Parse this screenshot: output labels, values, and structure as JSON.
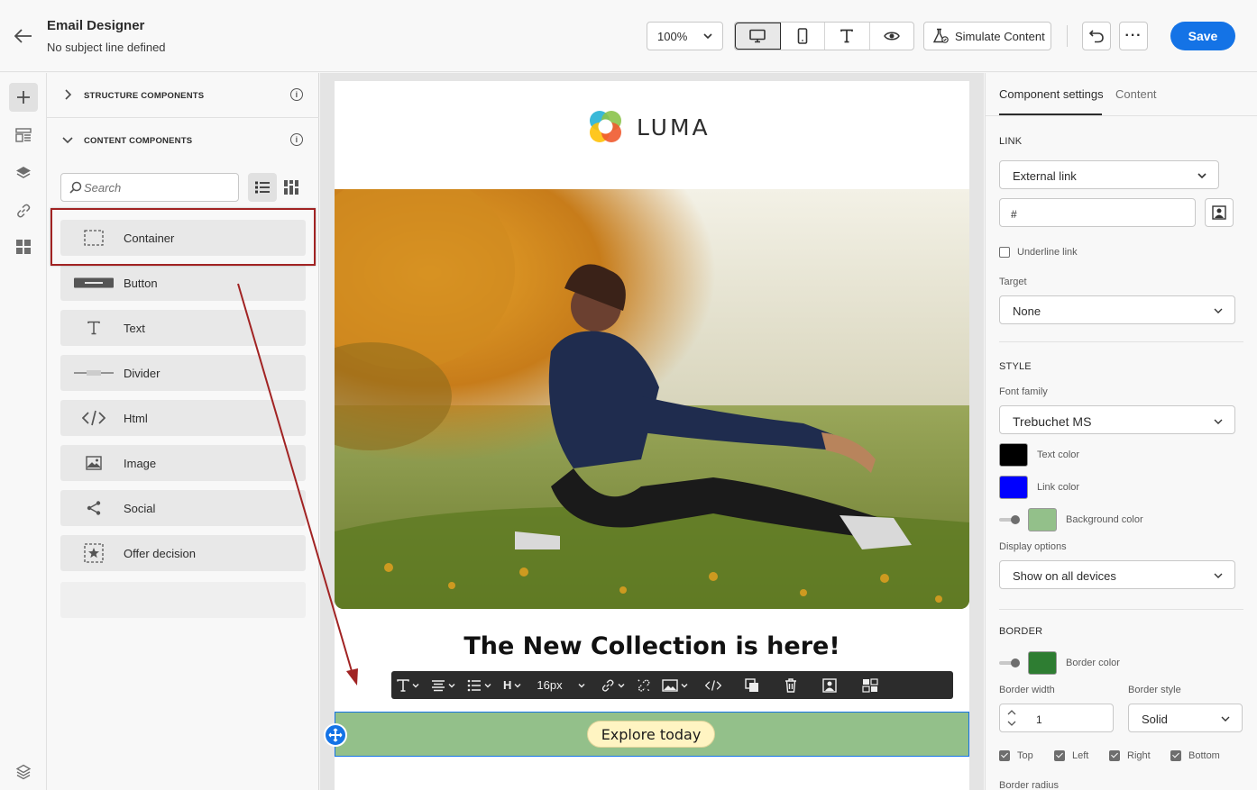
{
  "header": {
    "title": "Email Designer",
    "subtitle": "No subject line defined",
    "zoom": "100%",
    "simulate_label": "Simulate Content",
    "save_label": "Save"
  },
  "components_panel": {
    "structure_label": "STRUCTURE COMPONENTS",
    "content_label": "CONTENT COMPONENTS",
    "search_placeholder": "Search",
    "items": [
      {
        "label": "Container",
        "icon": "container-icon"
      },
      {
        "label": "Button",
        "icon": "button-icon"
      },
      {
        "label": "Text",
        "icon": "text-icon"
      },
      {
        "label": "Divider",
        "icon": "divider-icon"
      },
      {
        "label": "Html",
        "icon": "code-icon"
      },
      {
        "label": "Image",
        "icon": "image-icon"
      },
      {
        "label": "Social",
        "icon": "share-icon"
      },
      {
        "label": "Offer decision",
        "icon": "offer-icon"
      }
    ]
  },
  "canvas": {
    "logo_text": "LUMA",
    "headline": "The New Collection is here!",
    "cta_label": "Explore today",
    "font_size": "16px",
    "button_row_bg": "#93c08a"
  },
  "settings": {
    "tabs": [
      "Component settings",
      "Content"
    ],
    "link_section": "LINK",
    "link_type": "External link",
    "link_url": "#",
    "underline_label": "Underline link",
    "target_label": "Target",
    "target_value": "None",
    "style_section": "STYLE",
    "font_family_label": "Font family",
    "font_family_value": "Trebuchet MS",
    "text_color_label": "Text color",
    "text_color": "#000000",
    "link_color_label": "Link color",
    "link_color": "#0000ff",
    "background_color_label": "Background color",
    "background_color": "#93c08a",
    "display_options_label": "Display options",
    "display_options_value": "Show on all devices",
    "border_section": "BORDER",
    "border_color_label": "Border color",
    "border_color": "#2e7d32",
    "border_width_label": "Border width",
    "border_width_value": "1",
    "border_style_label": "Border style",
    "border_style_value": "Solid",
    "sides": [
      "Top",
      "Left",
      "Right",
      "Bottom"
    ],
    "border_radius_label": "Border radius"
  }
}
